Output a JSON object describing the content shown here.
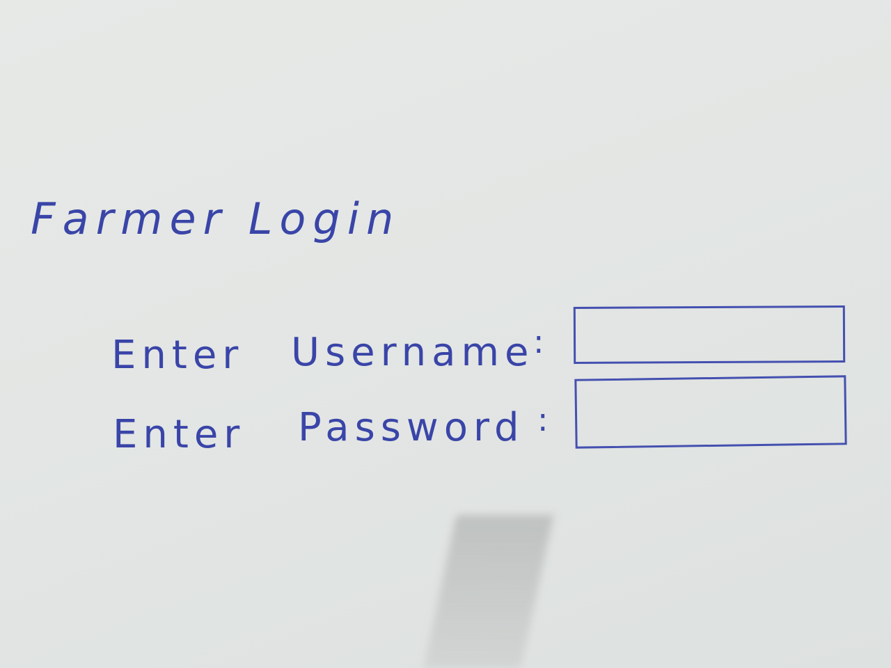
{
  "form": {
    "title": "Farmer Login",
    "username": {
      "label_word1": "Enter",
      "label_word2": "Username",
      "separator": ":",
      "value": "",
      "placeholder": ""
    },
    "password": {
      "label_word1": "Enter",
      "label_word2": "Password",
      "separator": ":",
      "value": "",
      "placeholder": ""
    }
  },
  "colors": {
    "ink": "#3a45a8",
    "paper": "#e4e7e5"
  }
}
